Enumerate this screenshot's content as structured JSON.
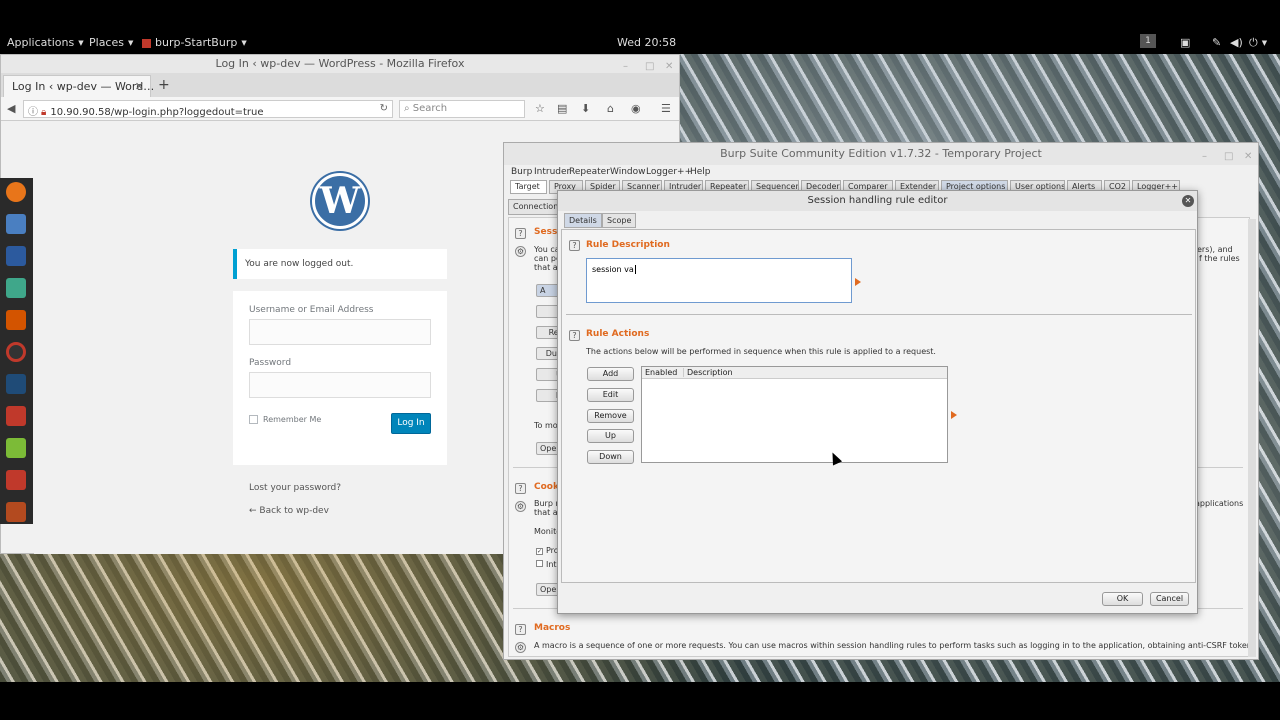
{
  "topbar": {
    "applications": "Applications",
    "places": "Places",
    "app": "burp-StartBurp",
    "clock": "Wed 20:58",
    "workspace": "1"
  },
  "firefox": {
    "window_title": "Log In ‹ wp-dev — WordPress - Mozilla Firefox",
    "tab_title": "Log In ‹ wp-dev — Word…",
    "new_tab": "+",
    "url": "10.90.90.58/wp-login.php?loggedout=true",
    "search_placeholder": "Search"
  },
  "wordpress": {
    "logo": "W",
    "message": "You are now logged out.",
    "username_label": "Username or Email Address",
    "password_label": "Password",
    "remember_label": "Remember Me",
    "login_button": "Log In",
    "lost_password": "Lost your password?",
    "back_link": "← Back to wp-dev"
  },
  "burp": {
    "window_title": "Burp Suite Community Edition v1.7.32 - Temporary Project",
    "menu": [
      "Burp",
      "Intruder",
      "Repeater",
      "Window",
      "Logger++",
      "Help"
    ],
    "tabs": [
      "Target",
      "Proxy",
      "Spider",
      "Scanner",
      "Intruder",
      "Repeater",
      "Sequencer",
      "Decoder",
      "Comparer",
      "Extender",
      "Project options",
      "User options",
      "Alerts",
      "CO2",
      "Logger++"
    ],
    "subtab": "Connection",
    "sessions_head": "Sess",
    "sessions_text_1": "You ca",
    "sessions_text_2": "can pe",
    "sessions_text_3": "that ar",
    "sessions_right_1": "ers), and",
    "sessions_right_2": "f the rules",
    "left_buttons": [
      "A",
      "E",
      "Rer",
      "Dup",
      "U",
      "D"
    ],
    "to_mo": "To mo",
    "ope_1": "Ope",
    "cookie_head": "Cook",
    "cookie_text_1": "Burp m",
    "cookie_text_2": "that ar",
    "cookie_right": "applications",
    "monito": "Monito",
    "pro": "Pro",
    "intr": "Intr",
    "ope_2": "Ope",
    "macros_head": "Macros",
    "macros_text": "A macro is a sequence of one or more requests. You can use macros within session handling rules to perform tasks such as logging in to the application, obtaining anti-CSRF tokens, etc."
  },
  "dialog": {
    "title": "Session handling rule editor",
    "tabs": [
      "Details",
      "Scope"
    ],
    "rule_description_head": "Rule Description",
    "rule_description_value": "session va",
    "rule_actions_head": "Rule Actions",
    "rule_actions_text": "The actions below will be performed in sequence when this rule is applied to a request.",
    "buttons": [
      "Add",
      "Edit",
      "Remove",
      "Up",
      "Down"
    ],
    "columns": [
      "Enabled",
      "Description"
    ],
    "ok": "OK",
    "cancel": "Cancel"
  },
  "colors": {
    "burp_accent": "#e06a20",
    "wp_blue": "#0085ba"
  }
}
